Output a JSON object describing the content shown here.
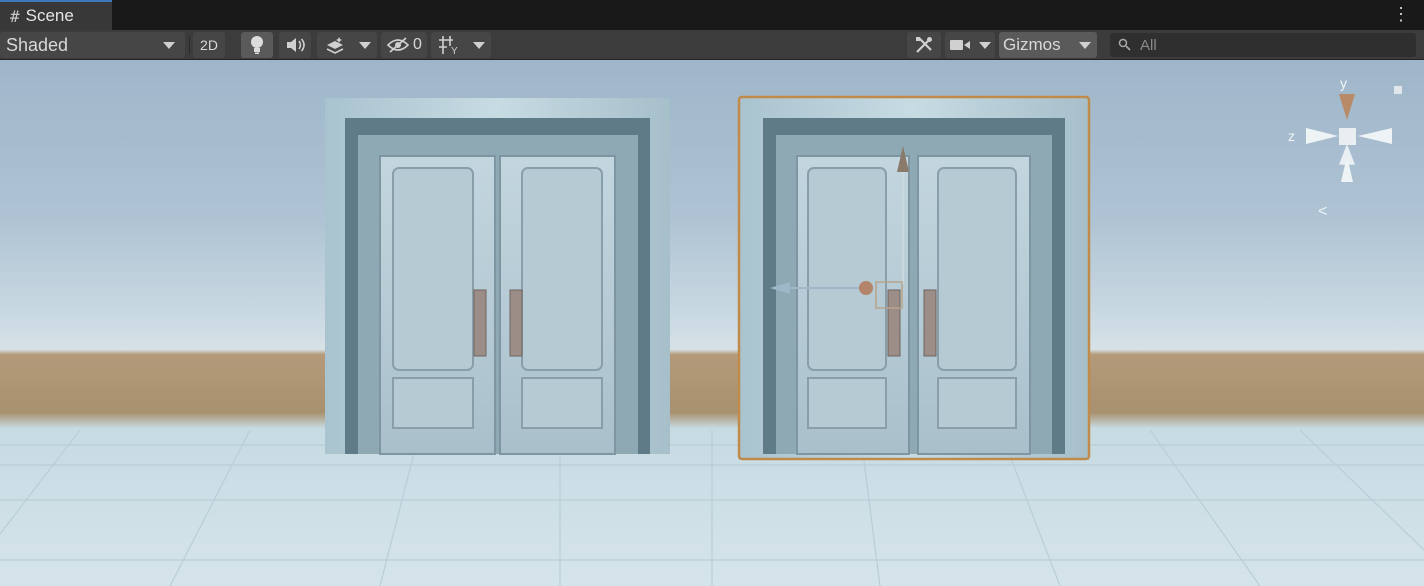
{
  "window": {
    "tab_title": "Scene",
    "tab_icon": "hash-icon",
    "menu_icon": "kebab-menu-icon"
  },
  "toolbar": {
    "draw_mode": "Shaded",
    "mode_2d": "2D",
    "hidden_count": "0",
    "gizmos_label": "Gizmos",
    "search_placeholder": "All",
    "icons": [
      "lighting-icon",
      "audio-icon",
      "effects-icon",
      "visibility-icon",
      "grid-icon",
      "tools-icon",
      "camera-icon",
      "search-icon"
    ]
  },
  "orientation_gizmo": {
    "y_label": "y",
    "z_label": "z",
    "perspective_label": "<"
  },
  "colors": {
    "selection_outline": "#c08a4a",
    "tab_accent": "#3a79bb",
    "toolbar_bg": "#3c3c3c"
  }
}
